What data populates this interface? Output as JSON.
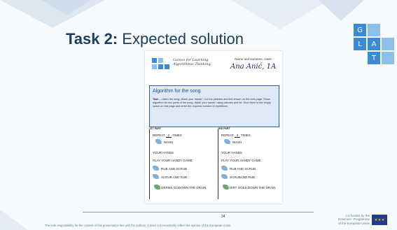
{
  "slide": {
    "title_bold": "Task 2:",
    "title_rest": " Expected solution",
    "logo_tiles": [
      "G",
      "L",
      "A",
      "T"
    ],
    "colors": {
      "title": "#1c3d5c",
      "accent": "#2f5fa3",
      "tile_blue": "#3a8ad6",
      "tile_light": "#8cc0ea"
    }
  },
  "doc": {
    "logo_text": [
      "Games for Learning",
      "Algorithmic Thinking"
    ],
    "name_label": "Name and surname, class:",
    "name_value": "Ana Anić, 1A",
    "alg_title": "Algorithm for the song",
    "task_label": "Task",
    "task_text": " – Listen the song „Wash your hands“. Cut the pictures and text shown on the next page. Show algorithm for two parts of the song „Wash your hands“ using pictures and txt. Glue them to the empty space on this page and enter the required number of repetitions.",
    "part1_label": "1ST PART",
    "part2_label": "2ND PART",
    "part1": {
      "repeat_prefix": "REPEAT",
      "repeat_count": "2",
      "repeat_suffix": "TIMES",
      "wash": "WASH",
      "your_hands": "YOUR HANDS",
      "play": "PLAY YOUR HANDY GAME",
      "rub": "RUB AND SCRUB",
      "scrub": "SCRUB AND RUB",
      "germs": "GERMS GODOWN THE DRAIN"
    },
    "part2": {
      "repeat_prefix": "REPEAT",
      "repeat_count": "3",
      "repeat_suffix": "TIMES",
      "wash": "WASH",
      "your_hands": "YOUR HANDS",
      "play": "PLAY YOUR HANDY GAME",
      "rub": "RUB AND SCRUB",
      "scrub": "SCRUBAND RUB",
      "germs": "DIRT GOES DOWN THE DRAIN"
    }
  },
  "footer": {
    "page_number": "24",
    "disclaimer": "The sole responsibility for the content of this presentation lies with the authors. It does not necessarily reflect the opinion of the European Union.",
    "cofunded": [
      "Co-funded by the",
      "Erasmus+ Programme",
      "of the European Union"
    ]
  }
}
